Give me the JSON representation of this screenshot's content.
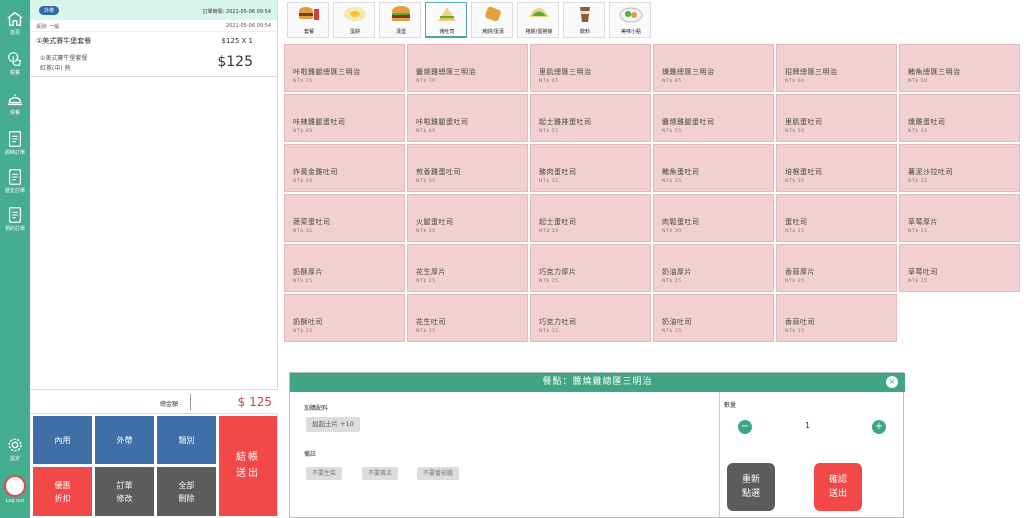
{
  "sidebar": {
    "items": [
      {
        "label": "首頁",
        "icon": "home-icon"
      },
      {
        "label": "點餐",
        "icon": "hand-pointer-icon"
      },
      {
        "label": "候餐",
        "icon": "bell-icon"
      },
      {
        "label": "即時訂單",
        "icon": "document-icon"
      },
      {
        "label": "歷史訂單",
        "icon": "document-icon"
      },
      {
        "label": "預約訂單",
        "icon": "document-icon"
      }
    ],
    "settings_label": "設定",
    "logout_label": "Log out"
  },
  "order": {
    "badge": "外帶",
    "order_time": "訂單時間: 2021-05-06 09:54",
    "sub_label": "桌別: 一般",
    "sub_time": "2021-05-06 09:54",
    "item": {
      "name": "①美式賽牛堡套餐",
      "qty": "$125 X 1",
      "detail1": "①美式賽牛堡套餐",
      "detail2": "紅茶(中) 熱",
      "price": "$125"
    },
    "total_label": "總金額",
    "total_amount": "$ 125",
    "buttons": {
      "dine_in": "內用",
      "takeout": "外帶",
      "category": "類別",
      "checkout": "結帳\n送出",
      "discount": "優惠\n折扣",
      "modify": "訂單\n修改",
      "delete_all": "全部\n刪除"
    }
  },
  "categories": [
    {
      "label": "套餐",
      "icon": "burger-set-icon"
    },
    {
      "label": "蛋餅",
      "icon": "egg-pancake-icon"
    },
    {
      "label": "漢堡",
      "icon": "burger-icon"
    },
    {
      "label": "烤吐司",
      "icon": "toast-sandwich-icon"
    },
    {
      "label": "烤餅/蛋漢",
      "icon": "toast-icon"
    },
    {
      "label": "捲餅/蛋捲條",
      "icon": "wrap-icon"
    },
    {
      "label": "飲料",
      "icon": "drink-cup-icon"
    },
    {
      "label": "美味小點",
      "icon": "snack-plate-icon"
    }
  ],
  "active_category": 3,
  "menu": [
    {
      "name": "咔啦雞腿總匯三明治",
      "price": "NT$ 75"
    },
    {
      "name": "醬燒雞總匯三明治",
      "price": "NT$ 70"
    },
    {
      "name": "里肌總匯三明治",
      "price": "NT$ 65"
    },
    {
      "name": "燻雞總匯三明治",
      "price": "NT$ 65"
    },
    {
      "name": "招牌總匯三明治",
      "price": "NT$ 60"
    },
    {
      "name": "鮪魚總匯三明治",
      "price": "NT$ 60"
    },
    {
      "name": "咔辣雞腿蛋吐司",
      "price": "NT$ 60"
    },
    {
      "name": "咔啦雞腿蛋吐司",
      "price": "NT$ 60"
    },
    {
      "name": "起士雞排蛋吐司",
      "price": "NT$ 55"
    },
    {
      "name": "醬燒雞腿蛋吐司",
      "price": "NT$ 55"
    },
    {
      "name": "里肌蛋吐司",
      "price": "NT$ 50"
    },
    {
      "name": "燻雞蛋吐司",
      "price": "NT$ 45"
    },
    {
      "name": "炸黃金雞吐司",
      "price": "NT$ 40"
    },
    {
      "name": "煎香雞蛋吐司",
      "price": "NT$ 35"
    },
    {
      "name": "豬肉蛋吐司",
      "price": "NT$ 35"
    },
    {
      "name": "鮪魚蛋吐司",
      "price": "NT$ 35"
    },
    {
      "name": "培根蛋吐司",
      "price": "NT$ 35"
    },
    {
      "name": "薯泥沙拉吐司",
      "price": "NT$ 35"
    },
    {
      "name": "蔬菜蛋吐司",
      "price": "NT$ 35"
    },
    {
      "name": "火腿蛋吐司",
      "price": "NT$ 30"
    },
    {
      "name": "起士蛋吐司",
      "price": "NT$ 30"
    },
    {
      "name": "肉鬆蛋吐司",
      "price": "NT$ 30"
    },
    {
      "name": "蛋吐司",
      "price": "NT$ 25"
    },
    {
      "name": "草莓厚片",
      "price": "NT$ 25"
    },
    {
      "name": "奶酥厚片",
      "price": "NT$ 25"
    },
    {
      "name": "花生厚片",
      "price": "NT$ 25"
    },
    {
      "name": "巧克力厚片",
      "price": "NT$ 25"
    },
    {
      "name": "奶油厚片",
      "price": "NT$ 25"
    },
    {
      "name": "香蒜厚片",
      "price": "NT$ 25"
    },
    {
      "name": "草莓吐司",
      "price": "NT$ 15"
    },
    {
      "name": "奶酥吐司",
      "price": "NT$ 15"
    },
    {
      "name": "花生吐司",
      "price": "NT$ 15"
    },
    {
      "name": "巧克力吐司",
      "price": "NT$ 15"
    },
    {
      "name": "奶油吐司",
      "price": "NT$ 15"
    },
    {
      "name": "香蒜吐司",
      "price": "NT$ 15"
    }
  ],
  "modal": {
    "title": "餐點：醬燒雞總匯三明治",
    "close": "×",
    "addons_label": "加購配料",
    "addon_option": "加起士片 +10",
    "notes_label": "備註",
    "notes": [
      "不要生菜",
      "不要黃瓜",
      "不要番茄醬"
    ],
    "qty_label": "數量",
    "qty_minus": "−",
    "qty_value": "1",
    "qty_plus": "+",
    "reset": "重新\n點選",
    "confirm": "確認\n送出"
  },
  "colors": {
    "primary": "#45ac8e",
    "blue": "#3f6fa6",
    "red": "#f24848",
    "gray": "#5c5c5c",
    "card": "#f2cfd1"
  }
}
